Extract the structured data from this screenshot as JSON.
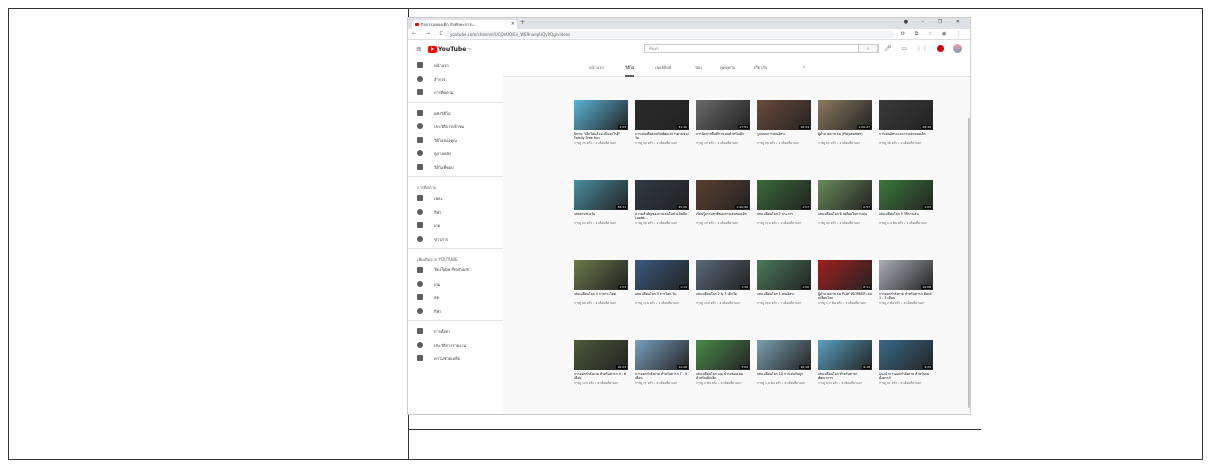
{
  "browser": {
    "tab_title": "กิจกรรมของเด็ก กับทักษะการเ...",
    "url": "youtube.com/channel/UCQeUQiEv_WE9naepUQyPQg/videos",
    "new_tab": "+",
    "window_controls": "●  –  ❐  ✕",
    "nav_buttons": "← → C",
    "extensions": "⚙ ⧉ ☆ ◉ ⋮"
  },
  "youtube": {
    "logo_text": "YouTube",
    "logo_suffix": "TH",
    "search_placeholder": "ค้นหา",
    "search_icon": "🔍"
  },
  "sidebar": {
    "main": [
      {
        "label": "หน้าแรก",
        "icon": "home-icon"
      },
      {
        "label": "สำรวจ",
        "icon": "explore-icon"
      },
      {
        "label": "การติดตาม",
        "icon": "subscriptions-icon"
      }
    ],
    "library": [
      {
        "label": "คลังวิดีโอ",
        "icon": "library-icon"
      },
      {
        "label": "ประวัติการเข้าชม",
        "icon": "history-icon"
      },
      {
        "label": "วิดีโอของคุณ",
        "icon": "your-videos-icon"
      },
      {
        "label": "ดูภายหลัง",
        "icon": "watch-later-icon"
      },
      {
        "label": "วิดีโอที่ชอบ",
        "icon": "liked-icon"
      }
    ],
    "subs_heading": "การติดตาม",
    "subs": [
      {
        "label": "เพลง",
        "icon": "music-icon"
      },
      {
        "label": "กีฬา",
        "icon": "sports-icon"
      },
      {
        "label": "เกม",
        "icon": "gaming-icon"
      },
      {
        "label": "ข่าวสาร",
        "icon": "news-icon"
      }
    ],
    "more_heading": "เพิ่มเติมจาก YOUTUBE",
    "more": [
      {
        "label": "YouTube Premium",
        "icon": "premium-icon"
      },
      {
        "label": "เกม",
        "icon": "gaming-icon"
      },
      {
        "label": "สด",
        "icon": "live-icon"
      },
      {
        "label": "กีฬา",
        "icon": "sports-icon"
      }
    ],
    "footer": [
      {
        "label": "การตั้งค่า",
        "icon": "settings-icon"
      },
      {
        "label": "ประวัติการรายงาน",
        "icon": "flag-icon"
      },
      {
        "label": "ความช่วยเหลือ",
        "icon": "help-icon"
      }
    ]
  },
  "channel_tabs": [
    "หน้าแรก",
    "วิดีโอ",
    "เพลย์ลิสต์",
    "ช่อง",
    "พูดคุยกัน",
    "เกี่ยวกับ"
  ],
  "videos": [
    {
      "title": "นิทาน \"เด็กโตแล้วจะเป็นอะไรดี\" Family Free Fun",
      "meta": "การดู 75 ครั้ง • 2 เดือนที่ผ่านมา",
      "duration": "3:53",
      "color": "#5cb3d6"
    },
    {
      "title": "การเล่นเพื่อส่งเสริมพัฒนาการตามช่วงวัย",
      "meta": "การดู 36 ครั้ง • 2 เดือนที่ผ่านมา",
      "duration": "31:40",
      "color": "#2b2b2b"
    },
    {
      "title": "การจัดการพื้นที่การเล่นสำหรับเด็ก",
      "meta": "การดู 15 ครั้ง • 2 เดือนที่ผ่านมา",
      "duration": "27:51",
      "color": "#6a6a6a"
    },
    {
      "title": "รูปแบบการเล่นอิสระ",
      "meta": "การดู 28 ครั้ง • 2 เดือนที่ผ่านมา",
      "duration": "16:34",
      "color": "#6b4a3c"
    },
    {
      "title": "ผู้อำนวยการเล่น (Playworker)",
      "meta": "การดู 51 ครั้ง • 2 เดือนที่ผ่านมา",
      "duration": "1:00:27",
      "color": "#8a7a60"
    },
    {
      "title": "การเล่นอิสระและการเล่นของเด็ก",
      "meta": "การดู 36 ครั้ง • 2 เดือนที่ผ่านมา",
      "duration": "28:49",
      "color": "#3a3a3a"
    },
    {
      "title": "เล่นตามช่วงวัย",
      "meta": "การดู 24 ครั้ง • 2 เดือนที่ผ่านมา",
      "duration": "38:31",
      "color": "#4a8fa0"
    },
    {
      "title": "ความสำคัญของการเล่นในช่วงวัยเด็ก Loose...",
      "meta": "การดู 26 ครั้ง • 2 เดือนที่ผ่านมา",
      "duration": "45:06",
      "color": "#2e3a46"
    },
    {
      "title": "เรียนรู้ธรรมชาติของการเล่นของเด็ก",
      "meta": "การดู 15 ครั้ง • 2 เดือนที่ผ่านมา",
      "duration": "1:00:40",
      "color": "#5a4030"
    },
    {
      "title": "เล่นเปลี่ยนโลก 7 ประการ",
      "meta": "การดู 110 ครั้ง • 4 เดือนที่ผ่านมา",
      "duration": "1:57",
      "color": "#3a6a3a"
    },
    {
      "title": "เล่นเปลี่ยนโลก 6 เหลี่ยมในการเล่น",
      "meta": "การดู 95 ครั้ง • 4 เดือนที่ผ่านมา",
      "duration": "0:57",
      "color": "#6a8a5a"
    },
    {
      "title": "เล่นเปลี่ยนโลก 5 วิถีการเล่น",
      "meta": "การดู 1.4 พัน ครั้ง • 4 เดือนที่ผ่านมา",
      "duration": "1:03",
      "color": "#3c7a3c"
    },
    {
      "title": "เล่นเปลี่ยนโลก 4 การกระโดด",
      "meta": "การดู 96 ครั้ง • 4 เดือนที่ผ่านมา",
      "duration": "1:53",
      "color": "#6a7a4a"
    },
    {
      "title": "เล่นเปลี่ยนโลก 3 การโยน รับ",
      "meta": "การดู 110 ครั้ง • 4 เดือนที่ผ่านมา",
      "duration": "1:13",
      "color": "#3a5a80"
    },
    {
      "title": "เล่นเปลี่ยนโลก 2 & 3 เด็กวัย",
      "meta": "การดู 102 ครั้ง • 4 เดือนที่ผ่านมา",
      "duration": "1:16",
      "color": "#5a6a7a"
    },
    {
      "title": "เล่นเปลี่ยนโลก 1 เล่นอิสระ",
      "meta": "การดู 260 ครั้ง • 7 เดือนที่ผ่านมา",
      "duration": "1:50",
      "color": "#4a7a5a"
    },
    {
      "title": "ผู้อำนวยการเล่น PLAY WORKER เล่นเปลี่ยนโลก",
      "meta": "การดู 1.7 พัน ครั้ง • 7 เดือนที่ผ่านมา",
      "duration": "6:11",
      "color": "#a02020"
    },
    {
      "title": "การออกกำลังกาย สำหรับทารก ตั้งแต่ 1 - 3 เดือน",
      "meta": "การดู 2 พัน ครั้ง • 8 เดือนที่ผ่านมา",
      "duration": "16:08",
      "color": "#aab0b8"
    },
    {
      "title": "การออกกำลังกาย สำหรับทารก 4 - 6 เดือน",
      "meta": "การดู 123 ครั้ง • 8 เดือนที่ผ่านมา",
      "duration": "16:23",
      "color": "#4a5a3a"
    },
    {
      "title": "การออกกำลังกาย สำหรับทารก 7 - 9 เดือน",
      "meta": "การดู 71 ครั้ง • 8 เดือนที่ผ่านมา",
      "duration": "12:48",
      "color": "#7aa0c0"
    },
    {
      "title": "เล่นเปลี่ยนโลก แนะนำรถของเล่นสำหรับเด็กเล็ก",
      "meta": "การดู 2 พัน ครั้ง • 8 เดือนที่ผ่านมา",
      "duration": "3:02",
      "color": "#4a8a4a"
    },
    {
      "title": "เล่นเปลี่ยนโลก 10 การเล่นกับลูก",
      "meta": "การดู 1.8 พัน ครั้ง • 8 เดือนที่ผ่านมา",
      "duration": "10:18",
      "color": "#7aa0b0"
    },
    {
      "title": "เล่นเปลี่ยนโลก สำหรับทารกพัฒนาการ",
      "meta": "การดู 633 ครั้ง • 8 เดือนที่ผ่านมา",
      "duration": "9:18",
      "color": "#5aa0c0"
    },
    {
      "title": "แนะนำการออกกำลังกาย สำหรับแม่ตั้งครรภ์",
      "meta": "การดู 61 ครั้ง • 8 เดือนที่ผ่านมา",
      "duration": "4:29",
      "color": "#3a6a8a"
    }
  ]
}
